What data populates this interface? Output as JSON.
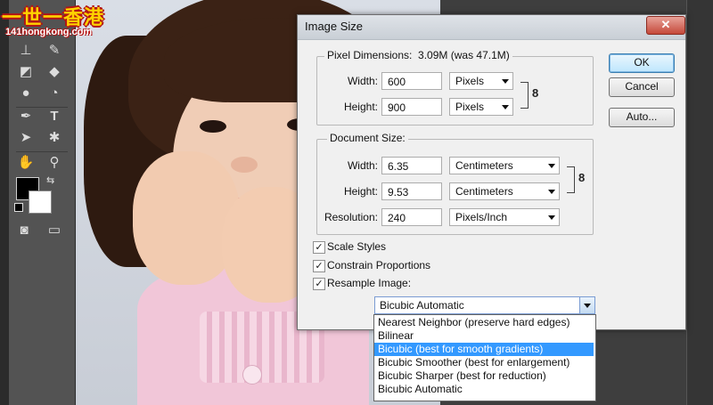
{
  "watermark": {
    "brand": "一世一香港",
    "site": "141hongkong.com"
  },
  "dialog": {
    "title": "Image Size",
    "close_icon": "close-icon",
    "pixel_dimensions": {
      "legend": "Pixel Dimensions:",
      "size_text": "3.09M (was 47.1M)",
      "width_label": "Width:",
      "width_value": "600",
      "width_unit": "Pixels",
      "height_label": "Height:",
      "height_value": "900",
      "height_unit": "Pixels"
    },
    "document_size": {
      "legend": "Document Size:",
      "width_label": "Width:",
      "width_value": "6.35",
      "width_unit": "Centimeters",
      "height_label": "Height:",
      "height_value": "9.53",
      "height_unit": "Centimeters",
      "resolution_label": "Resolution:",
      "resolution_value": "240",
      "resolution_unit": "Pixels/Inch"
    },
    "buttons": {
      "ok": "OK",
      "cancel": "Cancel",
      "auto": "Auto..."
    },
    "options": {
      "scale_styles": {
        "label": "Scale Styles",
        "checked": true
      },
      "constrain_proportions": {
        "label": "Constrain Proportions",
        "checked": true
      },
      "resample_image": {
        "label": "Resample Image:",
        "checked": true
      }
    },
    "resample_method": {
      "selected": "Bicubic Automatic",
      "items": [
        "Nearest Neighbor (preserve hard edges)",
        "Bilinear",
        "Bicubic (best for smooth gradients)",
        "Bicubic Smoother (best for enlargement)",
        "Bicubic Sharper (best for reduction)",
        "Bicubic Automatic"
      ],
      "highlighted_index": 2
    }
  },
  "colors": {
    "highlight": "#3399ff",
    "foreground_swatch": "#000000",
    "background_swatch": "#ffffff"
  }
}
